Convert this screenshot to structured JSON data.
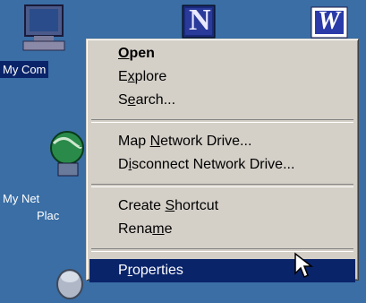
{
  "desktop": {
    "icons": [
      {
        "label": "My Computer",
        "label_visible": "My Com"
      },
      {
        "label": "My Network Places",
        "label_visible_line1": "My Net",
        "label_visible_line2": "Plac"
      }
    ],
    "top_icons": {
      "netscape_letter": "N",
      "word_letter": "W"
    }
  },
  "context_menu": {
    "groups": [
      [
        {
          "label_pre": "",
          "label_u": "O",
          "label_post": "pen",
          "bold": true
        },
        {
          "label_pre": "E",
          "label_u": "x",
          "label_post": "plore"
        },
        {
          "label_pre": "S",
          "label_u": "e",
          "label_post": "arch..."
        }
      ],
      [
        {
          "label_pre": "Map ",
          "label_u": "N",
          "label_post": "etwork Drive..."
        },
        {
          "label_pre": "D",
          "label_u": "i",
          "label_post": "sconnect Network Drive..."
        }
      ],
      [
        {
          "label_pre": "Create ",
          "label_u": "S",
          "label_post": "hortcut"
        },
        {
          "label_pre": "Rena",
          "label_u": "m",
          "label_post": "e"
        }
      ],
      [
        {
          "label_pre": "P",
          "label_u": "r",
          "label_post": "operties",
          "highlighted": true
        }
      ]
    ]
  },
  "colors": {
    "desktop": "#3a6ea5",
    "menu_bg": "#d4d0c8",
    "highlight": "#0a246a"
  }
}
